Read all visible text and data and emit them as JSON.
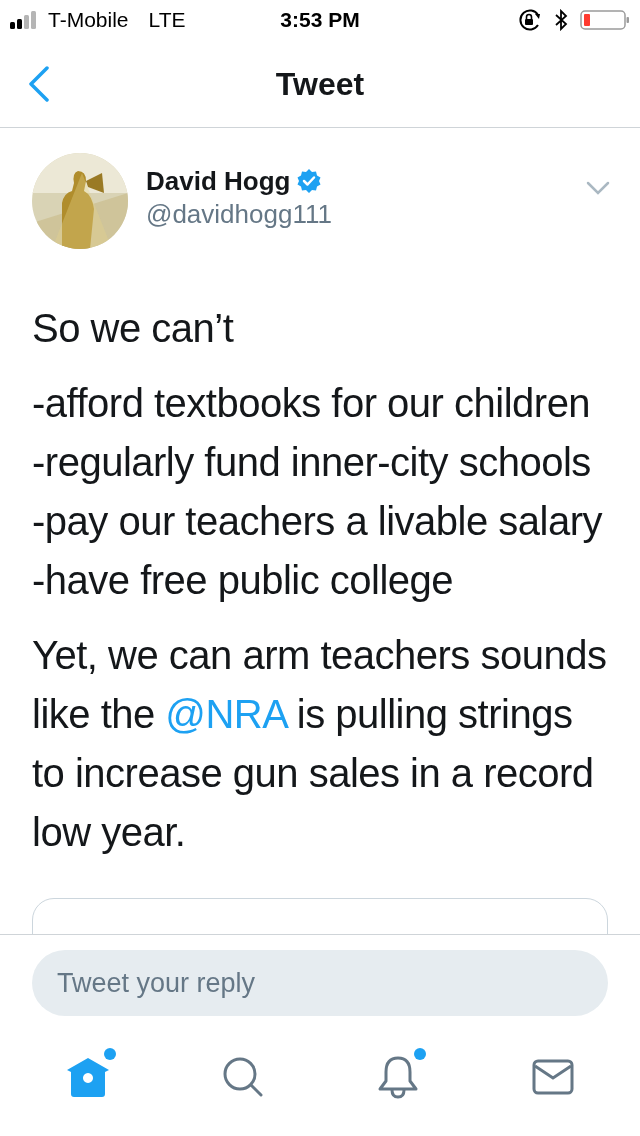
{
  "status_bar": {
    "carrier": "T-Mobile",
    "network": "LTE",
    "time": "3:53 PM"
  },
  "header": {
    "title": "Tweet"
  },
  "tweet": {
    "author": {
      "name": "David Hogg",
      "handle": "@davidhogg111",
      "verified": true
    },
    "paragraphs": [
      {
        "lines": [
          [
            {
              "kind": "text",
              "text": "So we can’t"
            }
          ]
        ]
      },
      {
        "lines": [
          [
            {
              "kind": "text",
              "text": "-afford textbooks for our children"
            }
          ],
          [
            {
              "kind": "text",
              "text": "-regularly fund inner-city schools"
            }
          ],
          [
            {
              "kind": "text",
              "text": "-pay our teachers a livable salary"
            }
          ],
          [
            {
              "kind": "text",
              "text": "-have free public college"
            }
          ]
        ]
      },
      {
        "lines": [
          [
            {
              "kind": "text",
              "text": "Yet, we can arm teachers sounds like the "
            },
            {
              "kind": "mention",
              "text": "@NRA"
            },
            {
              "kind": "text",
              "text": " is pulling strings to increase gun sales in a record low year."
            }
          ]
        ]
      }
    ]
  },
  "reply": {
    "placeholder": "Tweet your reply"
  },
  "tabs": [
    {
      "kind": "home",
      "selected": true,
      "unread": true
    },
    {
      "kind": "search",
      "selected": false,
      "unread": false
    },
    {
      "kind": "notifications",
      "selected": false,
      "unread": true
    },
    {
      "kind": "messages",
      "selected": false,
      "unread": false
    }
  ]
}
